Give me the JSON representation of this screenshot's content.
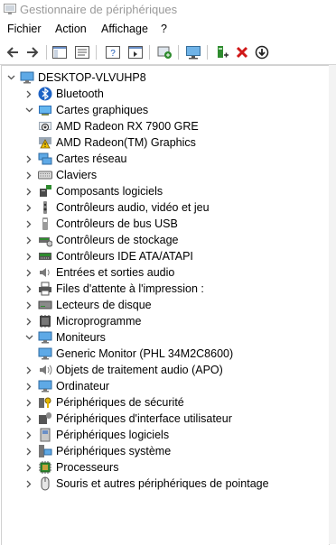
{
  "window": {
    "title": "Gestionnaire de périphériques"
  },
  "menu": {
    "items": [
      "Fichier",
      "Action",
      "Affichage",
      "?"
    ]
  },
  "toolbar": {
    "buttons": [
      "back-arrow-icon",
      "forward-arrow-icon",
      "show-hide-console-tree-icon",
      "properties-icon",
      "help-icon",
      "action-pane-icon",
      "update-driver-icon",
      "scan-hardware-icon",
      "add-legacy-icon",
      "uninstall-icon",
      "disable-icon"
    ],
    "colors": {
      "arrow": "#1e5bb8",
      "green": "#2e8b2e",
      "red": "#d01818"
    }
  },
  "tree": {
    "root": "DESKTOP-VLVUHP8",
    "items": [
      {
        "label": "Bluetooth",
        "icon": "bluetooth-icon",
        "expanded": false
      },
      {
        "label": "Cartes graphiques",
        "icon": "display-adapter-icon",
        "expanded": true
      },
      {
        "label": "AMD Radeon RX 7900 GRE",
        "icon": "display-adapter-disabled-icon",
        "child": true
      },
      {
        "label": "AMD Radeon(TM) Graphics",
        "icon": "display-adapter-warning-icon",
        "child": true
      },
      {
        "label": "Cartes réseau",
        "icon": "network-adapter-icon",
        "expanded": false
      },
      {
        "label": "Claviers",
        "icon": "keyboard-icon",
        "expanded": false
      },
      {
        "label": "Composants logiciels",
        "icon": "software-component-icon",
        "expanded": false
      },
      {
        "label": "Contrôleurs audio, vidéo et jeu",
        "icon": "audio-controller-icon",
        "expanded": false
      },
      {
        "label": "Contrôleurs de bus USB",
        "icon": "usb-icon",
        "expanded": false
      },
      {
        "label": "Contrôleurs de stockage",
        "icon": "storage-controller-icon",
        "expanded": false
      },
      {
        "label": "Contrôleurs IDE ATA/ATAPI",
        "icon": "ide-controller-icon",
        "expanded": false
      },
      {
        "label": "Entrées et sorties audio",
        "icon": "audio-io-icon",
        "expanded": false
      },
      {
        "label": "Files d'attente à l'impression :",
        "icon": "print-queue-icon",
        "expanded": false
      },
      {
        "label": "Lecteurs de disque",
        "icon": "disk-drive-icon",
        "expanded": false
      },
      {
        "label": "Microprogramme",
        "icon": "firmware-icon",
        "expanded": false
      },
      {
        "label": "Moniteurs",
        "icon": "monitor-icon",
        "expanded": true
      },
      {
        "label": "Generic Monitor (PHL 34M2C8600)",
        "icon": "monitor-icon",
        "child": true
      },
      {
        "label": "Objets de traitement audio (APO)",
        "icon": "audio-processing-icon",
        "expanded": false
      },
      {
        "label": "Ordinateur",
        "icon": "computer-icon",
        "expanded": false
      },
      {
        "label": "Périphériques de sécurité",
        "icon": "security-device-icon",
        "expanded": false
      },
      {
        "label": "Périphériques d'interface utilisateur",
        "icon": "hid-icon",
        "expanded": false
      },
      {
        "label": "Périphériques logiciels",
        "icon": "software-device-icon",
        "expanded": false
      },
      {
        "label": "Périphériques système",
        "icon": "system-device-icon",
        "expanded": false
      },
      {
        "label": "Processeurs",
        "icon": "processor-icon",
        "expanded": false
      },
      {
        "label": "Souris et autres périphériques de pointage",
        "icon": "mouse-icon",
        "expanded": false
      }
    ]
  }
}
